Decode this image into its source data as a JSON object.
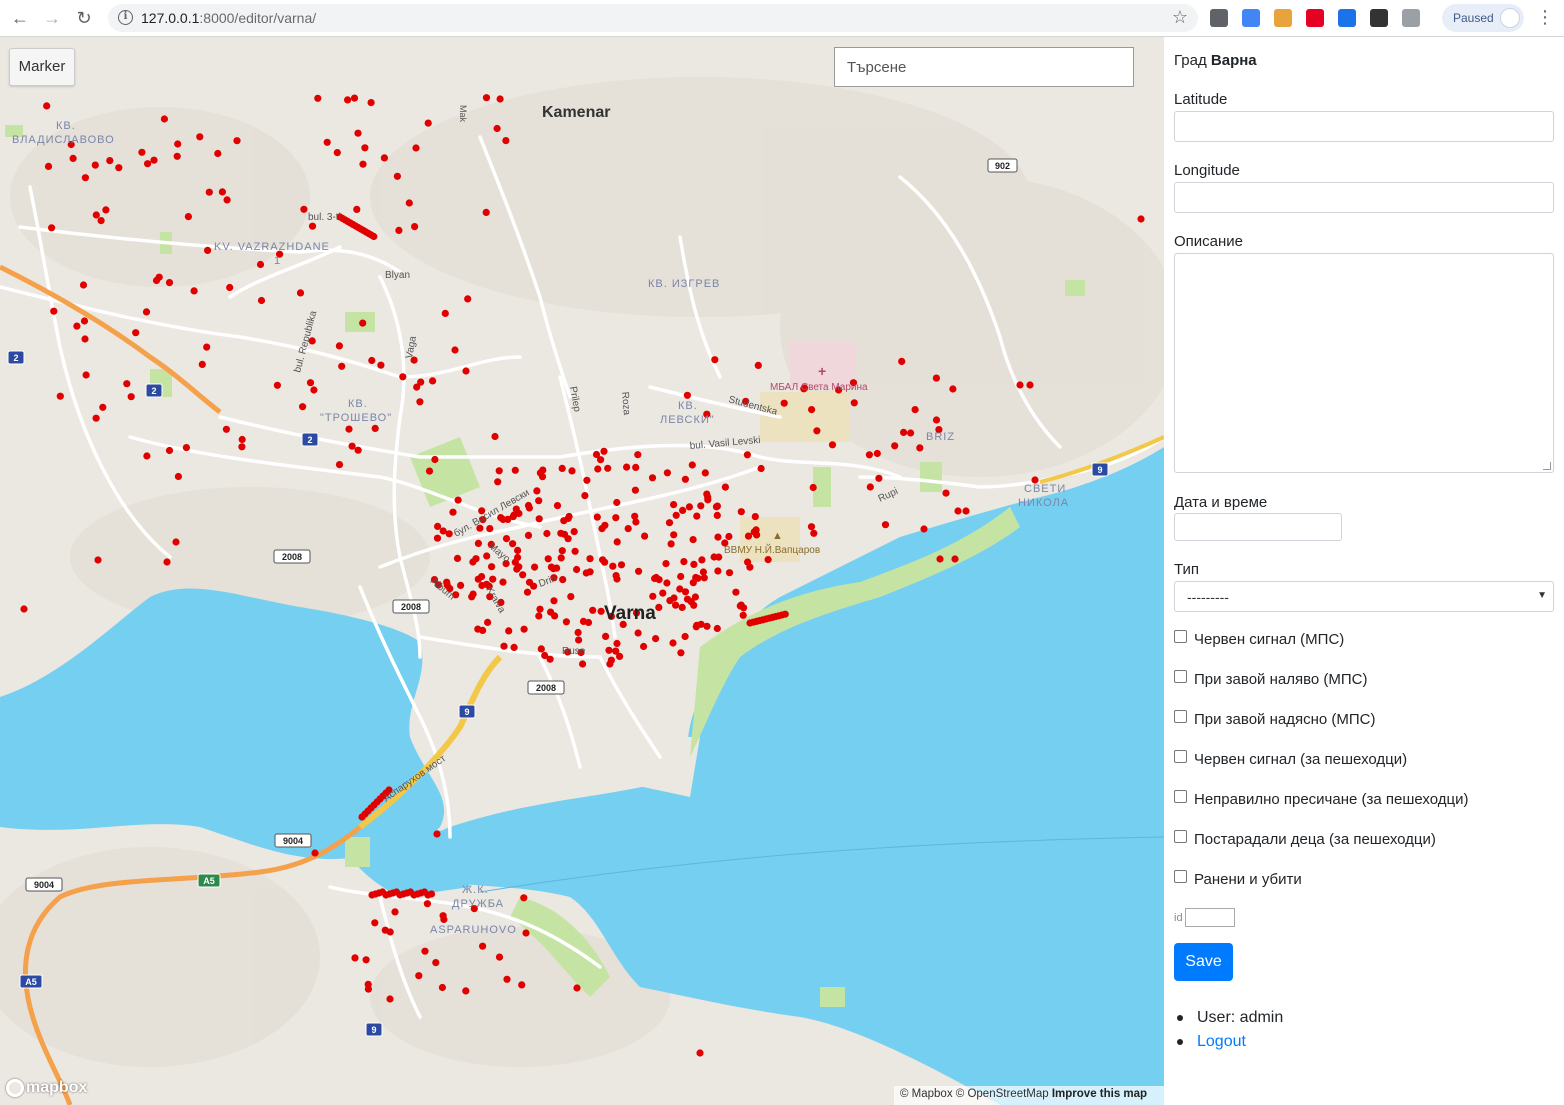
{
  "browser": {
    "url_host": "127.0.0.1",
    "url_port_path": ":8000/editor/varna/",
    "profile_status": "Paused",
    "extensions": [
      {
        "name": "apps-grid-icon",
        "color": "#5f6368"
      },
      {
        "name": "translate-icon",
        "color": "#4285f4"
      },
      {
        "name": "calendar-icon",
        "color": "#e8a33d"
      },
      {
        "name": "pinterest-icon",
        "color": "#e60023"
      },
      {
        "name": "download-icon",
        "color": "#1a73e8"
      },
      {
        "name": "screenshot-icon",
        "color": "#333333"
      },
      {
        "name": "reader-icon",
        "color": "#9aa0a6"
      }
    ]
  },
  "map": {
    "marker_button": "Marker",
    "search_placeholder": "Търсене",
    "logo": "mapbox",
    "attribution": {
      "mapbox": "© Mapbox",
      "osm": "© OpenStreetMap",
      "improve": "Improve this map"
    },
    "colors": {
      "land": "#ebe7e1",
      "water": "#75cff0",
      "park": "#c5e4a4",
      "road": "#ffffff",
      "motorway": "#f5a04a",
      "bridge": "#f3c747",
      "marker": "#e00000"
    },
    "labels": {
      "kamenar": "Kamenar",
      "vladislavovo_1": "КВ.",
      "vladislavovo_2": "ВЛАДИСЛАВОВО",
      "vazrazhdane_1": "KV. VAZRAZHDANE",
      "vazrazhdane_2": "1",
      "izgrev": "КВ. ИЗГРЕВ",
      "troshevo_1": "КВ.",
      "troshevo_2": "\"ТРОШЕВО\"",
      "levski_1": "КВ.",
      "levski_2": "ЛЕВСКИ\"",
      "briz": "BRIZ",
      "sv_nikola_1": "СВЕТИ",
      "sv_nikola_2": "НИКОЛА",
      "varna": "Varna",
      "hospital": "МБАЛ Света Марина",
      "vvmu": "ВВМУ Н.Й.Вапцаров",
      "druzhba_1": "Ж.К.",
      "druzhba_2": "ДРУЖБА",
      "asparuhovo": "ASPARUHOVO",
      "bul3": "bul. 3-ti",
      "blyan": "Blyan",
      "republika": "bul. Republika",
      "vaga": "Vaga",
      "prilep": "Prilep",
      "roza": "Roza",
      "studentska": "Studentska",
      "bul_levski": "bul. Vasil Levski",
      "rupi": "Rupi",
      "bul_vl": "бул. Васил Левски",
      "mayo": "Mayo",
      "drin": "Drin",
      "kraiva": "Kraiva",
      "ruse": "Ruse",
      "album": "Album",
      "most": "Аспарухов мост",
      "mak": "Mak",
      "r902": "902",
      "r2a": "2",
      "r2b": "2",
      "r2c": "2",
      "r2008a": "2008",
      "r2008b": "2008",
      "r2008c": "2008",
      "r9a": "9",
      "r9b": "9",
      "r9c": "9",
      "r9004a": "9004",
      "r9004b": "9004",
      "a5a": "A5",
      "a5b": "A5"
    }
  },
  "form": {
    "city_prefix": "Град",
    "city_name": "Варна",
    "latitude_label": "Latitude",
    "longitude_label": "Longitude",
    "description_label": "Описание",
    "datetime_label": "Дата и време",
    "type_label": "Тип",
    "type_selected": "---------",
    "checkboxes": [
      {
        "label": "Червен сигнал (МПС)",
        "checked": false
      },
      {
        "label": "При завой наляво (МПС)",
        "checked": false
      },
      {
        "label": "При завой надясно (МПС)",
        "checked": false
      },
      {
        "label": "Червен сигнал (за пешеходци)",
        "checked": false
      },
      {
        "label": "Неправилно пресичане (за пешеходци)",
        "checked": false
      },
      {
        "label": "Постарадали деца (за пешеходци)",
        "checked": false
      },
      {
        "label": "Ранени и убити",
        "checked": false
      }
    ],
    "id_label": "id",
    "save_label": "Save",
    "user_text": "User: admin",
    "logout_text": "Logout"
  }
}
